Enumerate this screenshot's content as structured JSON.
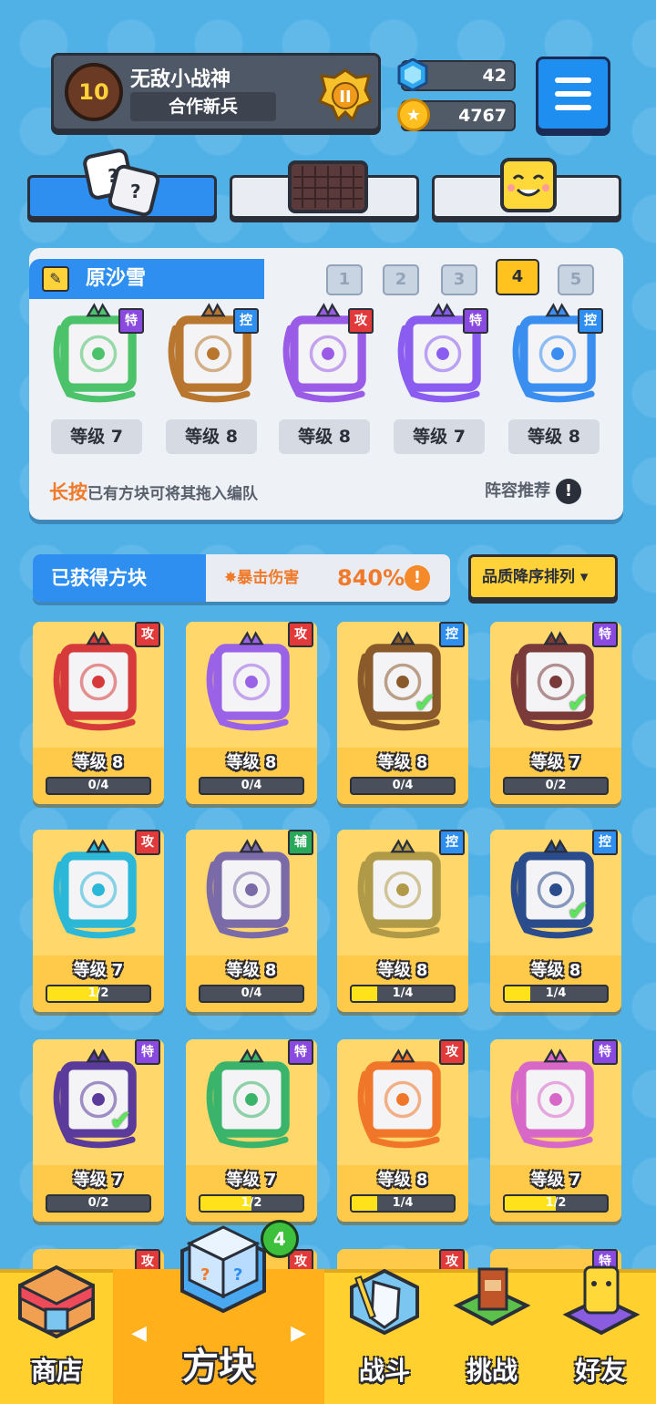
{
  "header": {
    "player_name": "无敌小战神",
    "player_title": "合作新兵",
    "avatar_level": "10",
    "avatar_small": "12",
    "rank_badge": "II",
    "gems": "42",
    "coins": "4767"
  },
  "team": {
    "name": "原沙雪",
    "slots": [
      "1",
      "2",
      "3",
      "4",
      "5"
    ],
    "active_slot": "4",
    "members": [
      {
        "role": "特",
        "level": "等级 7",
        "color": "#4cc36a"
      },
      {
        "role": "控",
        "level": "等级 8",
        "color": "#b8762e"
      },
      {
        "role": "攻",
        "level": "等级 8",
        "color": "#9a5ce6"
      },
      {
        "role": "特",
        "level": "等级 7",
        "color": "#8a5cf0"
      },
      {
        "role": "控",
        "level": "等级 8",
        "color": "#3a8ef0"
      }
    ],
    "hint_strong": "长按",
    "hint": "已有方块可将其拖入编队",
    "recommend": "阵容推荐",
    "recommend_icon": "!"
  },
  "owned": {
    "label": "已获得方块",
    "crit_label": "暴击伤害",
    "crit_value": "840%",
    "crit_info": "!",
    "sort_label": "品质降序排列"
  },
  "cards": [
    {
      "role": "攻",
      "level": "等级 8",
      "progress": "0/4",
      "fill": 0,
      "checked": false,
      "color": "#d63a3a"
    },
    {
      "role": "攻",
      "level": "等级 8",
      "progress": "0/4",
      "fill": 0,
      "checked": false,
      "color": "#9a62e6"
    },
    {
      "role": "控",
      "level": "等级 8",
      "progress": "0/4",
      "fill": 0,
      "checked": true,
      "color": "#8a5a2a"
    },
    {
      "role": "特",
      "level": "等级 7",
      "progress": "0/2",
      "fill": 0,
      "checked": true,
      "color": "#7a3a3a"
    },
    {
      "role": "攻",
      "level": "等级 7",
      "progress": "1/2",
      "fill": 0.5,
      "checked": false,
      "color": "#2ab7d8"
    },
    {
      "role": "辅",
      "level": "等级 8",
      "progress": "0/4",
      "fill": 0,
      "checked": false,
      "color": "#7a6aa8"
    },
    {
      "role": "控",
      "level": "等级 8",
      "progress": "1/4",
      "fill": 0.25,
      "checked": false,
      "color": "#b09a48"
    },
    {
      "role": "控",
      "level": "等级 8",
      "progress": "1/4",
      "fill": 0.25,
      "checked": true,
      "color": "#2a4c8c"
    },
    {
      "role": "特",
      "level": "等级 7",
      "progress": "0/2",
      "fill": 0,
      "checked": true,
      "color": "#5a3a9a"
    },
    {
      "role": "特",
      "level": "等级 7",
      "progress": "1/2",
      "fill": 0.5,
      "checked": false,
      "color": "#3ab46a"
    },
    {
      "role": "攻",
      "level": "等级 8",
      "progress": "1/4",
      "fill": 0.25,
      "checked": false,
      "color": "#f0762a"
    },
    {
      "role": "特",
      "level": "等级 7",
      "progress": "1/2",
      "fill": 0.5,
      "checked": false,
      "color": "#d868c8"
    }
  ],
  "partial_row_roles": [
    "攻",
    "攻",
    "攻",
    "特"
  ],
  "role_colors": {
    "攻": "#e23a3a",
    "控": "#2f8ff0",
    "特": "#8a4ae0",
    "辅": "#2aa85a"
  },
  "check_icon": "✔",
  "nav": {
    "shop": "商店",
    "blocks": "方块",
    "blocks_badge": "4",
    "battle": "战斗",
    "challenge": "挑战",
    "friends": "好友",
    "arrow_left": "◀",
    "arrow_right": "▶"
  }
}
